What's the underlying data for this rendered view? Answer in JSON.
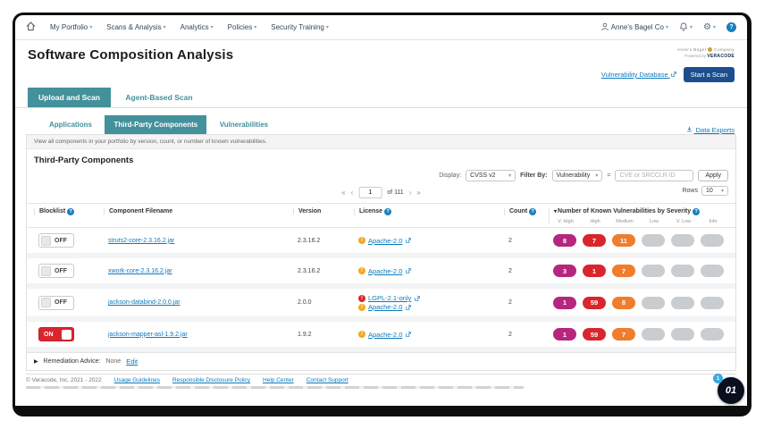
{
  "nav": {
    "items": [
      {
        "label": "My Portfolio"
      },
      {
        "label": "Scans & Analysis"
      },
      {
        "label": "Analytics"
      },
      {
        "label": "Policies"
      },
      {
        "label": "Security Training"
      }
    ],
    "account": "Anne's Bagel Co"
  },
  "header": {
    "title": "Software Composition Analysis",
    "brand_line1_a": "Anne's Bagel",
    "brand_line1_b": "Company",
    "powered_by": "Powered by",
    "brand_name": "VERACODE",
    "vuln_db_link": "Vulnerability Database",
    "start_scan": "Start a Scan"
  },
  "tabs": {
    "primary": [
      {
        "label": "Upload and Scan",
        "active": true
      },
      {
        "label": "Agent-Based Scan",
        "active": false
      }
    ],
    "secondary": [
      {
        "label": "Applications",
        "active": false
      },
      {
        "label": "Third-Party Components",
        "active": true
      },
      {
        "label": "Vulnerabilities",
        "active": false
      }
    ],
    "data_exports": "Data Exports"
  },
  "info_bar": "View all components in your portfolio by version, count, or number of known vulnerabilities.",
  "section_heading": "Third-Party Components",
  "controls": {
    "display_label": "Display:",
    "display_value": "CVSS v2",
    "filter_label": "Filter By:",
    "filter_value": "Vulnerability",
    "equals": "=",
    "search_placeholder": "CVE or SRCCLR ID",
    "apply": "Apply",
    "rows_label": "Rows",
    "rows_value": "10"
  },
  "pagination": {
    "page": "1",
    "of_total": "of 111"
  },
  "table": {
    "headers": {
      "blocklist": "Blocklist",
      "filename": "Component Filename",
      "version": "Version",
      "license": "License",
      "count": "Count",
      "severity": "Number of Known Vulnerabilities by Severity"
    },
    "severity_sublabels": [
      "V. High",
      "High",
      "Medium",
      "Low",
      "V. Low",
      "Info"
    ],
    "rows": [
      {
        "blocklist": "OFF",
        "filename": "struts2-core-2.3.16.2.jar",
        "version": "2.3.16.2",
        "licenses": [
          {
            "name": "Apache-2.0",
            "flag": "warning"
          }
        ],
        "count": "2",
        "severities": [
          "8",
          "7",
          "11",
          "",
          "",
          ""
        ]
      },
      {
        "blocklist": "OFF",
        "filename": "xwork-core-2.3.16.2.jar",
        "version": "2.3.16.2",
        "licenses": [
          {
            "name": "Apache-2.0",
            "flag": "warning"
          }
        ],
        "count": "2",
        "severities": [
          "3",
          "1",
          "7",
          "",
          "",
          ""
        ]
      },
      {
        "blocklist": "OFF",
        "filename": "jackson-databind-2.0.0.jar",
        "version": "2.0.0",
        "licenses": [
          {
            "name": "LGPL-2.1-only",
            "flag": "error"
          },
          {
            "name": "Apache-2.0",
            "flag": "warning"
          }
        ],
        "count": "2",
        "severities": [
          "1",
          "59",
          "8",
          "",
          "",
          ""
        ]
      },
      {
        "blocklist": "ON",
        "filename": "jackson-mapper-asl-1.9.2.jar",
        "version": "1.9.2",
        "licenses": [
          {
            "name": "Apache-2.0",
            "flag": "warning"
          }
        ],
        "count": "2",
        "severities": [
          "1",
          "59",
          "7",
          "",
          "",
          ""
        ]
      }
    ]
  },
  "remediation": {
    "label": "Remediation Advice:",
    "value": "None",
    "edit": "Edit"
  },
  "footer": {
    "copyright": "© Veracode, Inc. 2021 - 2022",
    "links": [
      "Usage Guidelines",
      "Responsible Disclosure Policy",
      "Help Center",
      "Contact Support"
    ]
  },
  "overlay": {
    "logo": "01",
    "badge": "1"
  },
  "colors": {
    "teal": "#43919b",
    "link_blue": "#0d7abc",
    "navy_button": "#1b4f8f",
    "sev_very_high": "#b5267c",
    "sev_high": "#d9262c",
    "sev_medium": "#ee7d2e",
    "sev_empty": "#c9cdd0",
    "toggle_on_red": "#d9262c",
    "license_warning": "#f2a91e",
    "license_error": "#d9262c"
  }
}
